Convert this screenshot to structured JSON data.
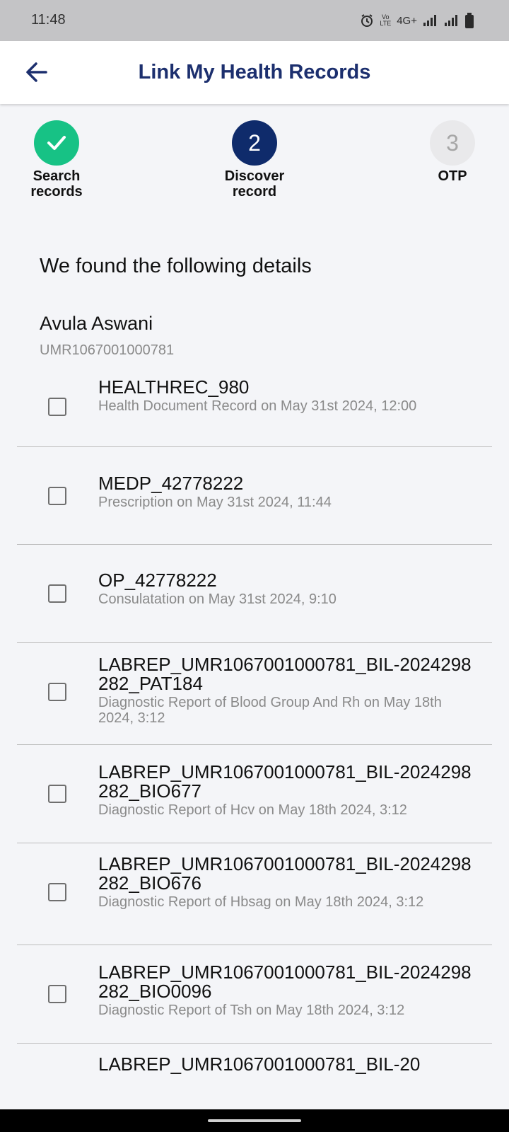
{
  "status_bar": {
    "time": "11:48",
    "network": "4G+"
  },
  "app_bar": {
    "title": "Link My Health Records"
  },
  "stepper": {
    "steps": [
      {
        "number": "1",
        "label": "Search records",
        "state": "completed"
      },
      {
        "number": "2",
        "label": "Discover record",
        "state": "active"
      },
      {
        "number": "3",
        "label": "OTP",
        "state": "pending"
      }
    ]
  },
  "details": {
    "heading": "We found the following details",
    "patient_name": "Avula Aswani",
    "patient_id": "UMR1067001000781"
  },
  "records": [
    {
      "title": "HEALTHREC_980",
      "subtitle": "Health Document Record on May 31st 2024, 12:00",
      "checked": false
    },
    {
      "title": "MEDP_42778222",
      "subtitle": "Prescription on May 31st 2024, 11:44",
      "checked": false
    },
    {
      "title": "OP_42778222",
      "subtitle": "Consulatation on May 31st 2024, 9:10",
      "checked": false
    },
    {
      "title": "LABREP_UMR1067001000781_BIL-2024298282_PAT184",
      "subtitle": "Diagnostic Report of Blood Group And Rh on May 18th 2024, 3:12",
      "checked": false
    },
    {
      "title": "LABREP_UMR1067001000781_BIL-2024298282_BIO677",
      "subtitle": "Diagnostic Report of Hcv on May 18th 2024, 3:12",
      "checked": false
    },
    {
      "title": "LABREP_UMR1067001000781_BIL-2024298282_BIO676",
      "subtitle": "Diagnostic Report of Hbsag on May 18th 2024, 3:12",
      "checked": false
    },
    {
      "title": "LABREP_UMR1067001000781_BIL-2024298282_BIO0096",
      "subtitle": "Diagnostic Report of Tsh on May 18th 2024, 3:12",
      "checked": false
    },
    {
      "title": "LABREP_UMR1067001000781_BIL-20",
      "subtitle": "",
      "checked": false
    }
  ],
  "colors": {
    "brand_navy": "#1c2f6e",
    "step_complete": "#17c285",
    "step_active": "#0f2b6b"
  }
}
